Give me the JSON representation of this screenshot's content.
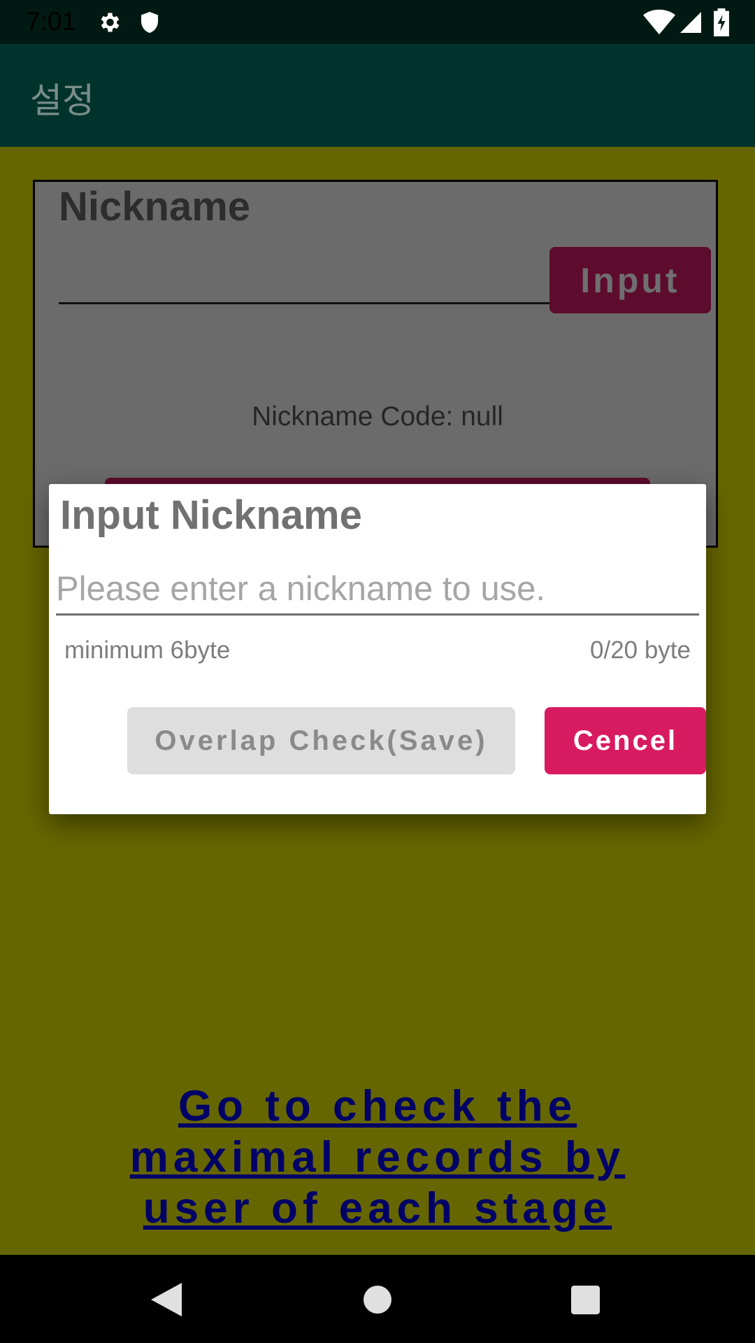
{
  "status_bar": {
    "time": "7:01",
    "icons": [
      "gear-icon",
      "shield-icon",
      "wifi-icon",
      "cell-signal-icon",
      "battery-charging-icon"
    ]
  },
  "app_bar": {
    "title": "설정"
  },
  "nickname_card": {
    "title": "Nickname",
    "input_button": "Input",
    "code_text": "Nickname Code: null"
  },
  "dialog": {
    "title": "Input Nickname",
    "input": {
      "value": "",
      "placeholder": "Please enter a nickname to use."
    },
    "helper_text": "minimum 6byte",
    "counter_text": "0/20 byte",
    "overlap_button": "Overlap Check(Save)",
    "cancel_button": "Cencel"
  },
  "records_link": {
    "text": "Go to check the maximal records by user of each stage"
  },
  "nav_bar": {
    "icons": [
      "back-icon",
      "home-icon",
      "recents-icon"
    ]
  },
  "colors": {
    "status_bar": "#001a13",
    "app_bar": "#00332c",
    "content_background": "#666600",
    "cancel_button": "#d81b60",
    "overlap_button": "#dedede",
    "link": "#000066"
  }
}
